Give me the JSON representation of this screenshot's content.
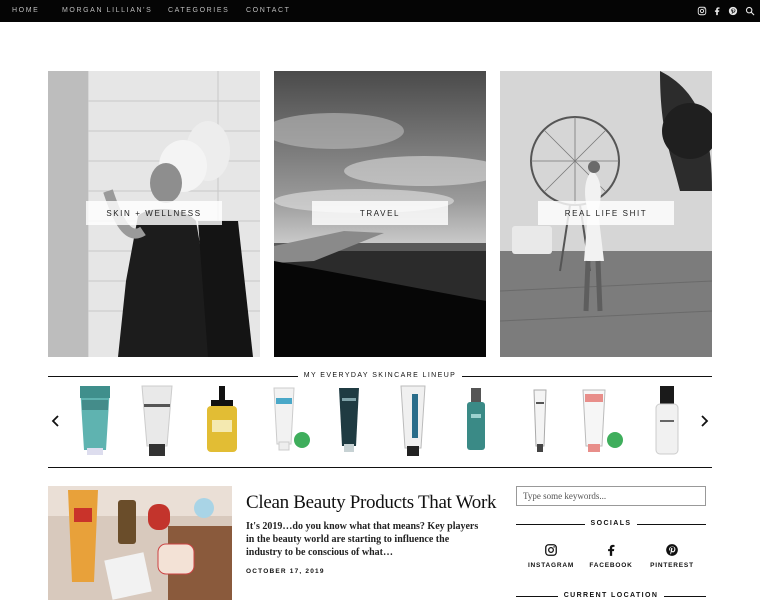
{
  "nav": {
    "items": [
      "HOME",
      "MORGAN LILLIAN'S",
      "CATEGORIES",
      "CONTACT"
    ],
    "icons": [
      "instagram-icon",
      "facebook-icon",
      "pinterest-icon",
      "search-icon"
    ]
  },
  "categories": [
    {
      "label": "SKIN + WELLNESS"
    },
    {
      "label": "TRAVEL"
    },
    {
      "label": "REAL LIFE SHIT"
    }
  ],
  "lineup": {
    "title": "MY EVERYDAY SKINCARE LINEUP",
    "prev_icon": "chevron-left-icon",
    "next_icon": "chevron-right-icon",
    "products": [
      {
        "name": "basis-cleanser"
      },
      {
        "name": "the-ordinary-tube"
      },
      {
        "name": "yellow-pump-bottle"
      },
      {
        "name": "white-tube-green-badge"
      },
      {
        "name": "dark-teal-tube"
      },
      {
        "name": "dermalogica-tube"
      },
      {
        "name": "teal-serum-bottle"
      },
      {
        "name": "slim-white-tube"
      },
      {
        "name": "pink-tube-green-badge"
      },
      {
        "name": "white-serum-bottle"
      }
    ]
  },
  "post": {
    "title": "Clean Beauty Products That Work",
    "excerpt": "It's 2019…do you know what that means? Key players in the beauty world are starting to influence the industry to be conscious of what…",
    "date": "OCTOBER 17, 2019"
  },
  "sidebar": {
    "search_placeholder": "Type some keywords...",
    "socials_heading": "SOCIALS",
    "socials": [
      {
        "label": "INSTAGRAM",
        "icon": "instagram-icon"
      },
      {
        "label": "FACEBOOK",
        "icon": "facebook-icon"
      },
      {
        "label": "PINTEREST",
        "icon": "pinterest-icon"
      }
    ],
    "location_heading": "CURRENT LOCATION"
  }
}
